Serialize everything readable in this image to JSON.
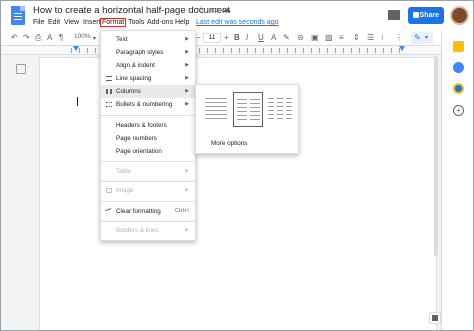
{
  "doc": {
    "title": "How to create a horizontal half-page document",
    "last_edit": "Last edit was seconds ago",
    "share_label": "Share"
  },
  "menubar": {
    "items": [
      "File",
      "Edit",
      "View",
      "Insert",
      "Format",
      "Tools",
      "Add-ons",
      "Help"
    ],
    "active": "Format"
  },
  "toolbar": {
    "zoom": "100%",
    "font_size": "11"
  },
  "format_menu": {
    "items": [
      {
        "label": "Text",
        "submenu": true,
        "disabled": false
      },
      {
        "label": "Paragraph styles",
        "submenu": true,
        "disabled": false
      },
      {
        "label": "Align & indent",
        "submenu": true,
        "disabled": false
      },
      {
        "label": "Line spacing",
        "submenu": true,
        "disabled": false
      },
      {
        "label": "Columns",
        "submenu": true,
        "disabled": false,
        "highlighted": true
      },
      {
        "label": "Bullets & numbering",
        "submenu": true,
        "disabled": false
      },
      {
        "label": "Headers & footers",
        "submenu": false,
        "disabled": false
      },
      {
        "label": "Page numbers",
        "submenu": false,
        "disabled": false
      },
      {
        "label": "Page orientation",
        "submenu": false,
        "disabled": false
      },
      {
        "label": "Table",
        "submenu": true,
        "disabled": true
      },
      {
        "label": "Image",
        "submenu": true,
        "disabled": true
      },
      {
        "label": "Clear formatting",
        "shortcut": "Ctrl+\\",
        "disabled": false
      },
      {
        "label": "Borders & lines",
        "submenu": true,
        "disabled": true
      }
    ]
  },
  "columns_menu": {
    "options": [
      "one-column",
      "two-columns",
      "three-columns"
    ],
    "selected": "two-columns",
    "more_options": "More options"
  },
  "colors": {
    "accent": "#1a73e8",
    "highlight_border": "#d93025"
  }
}
